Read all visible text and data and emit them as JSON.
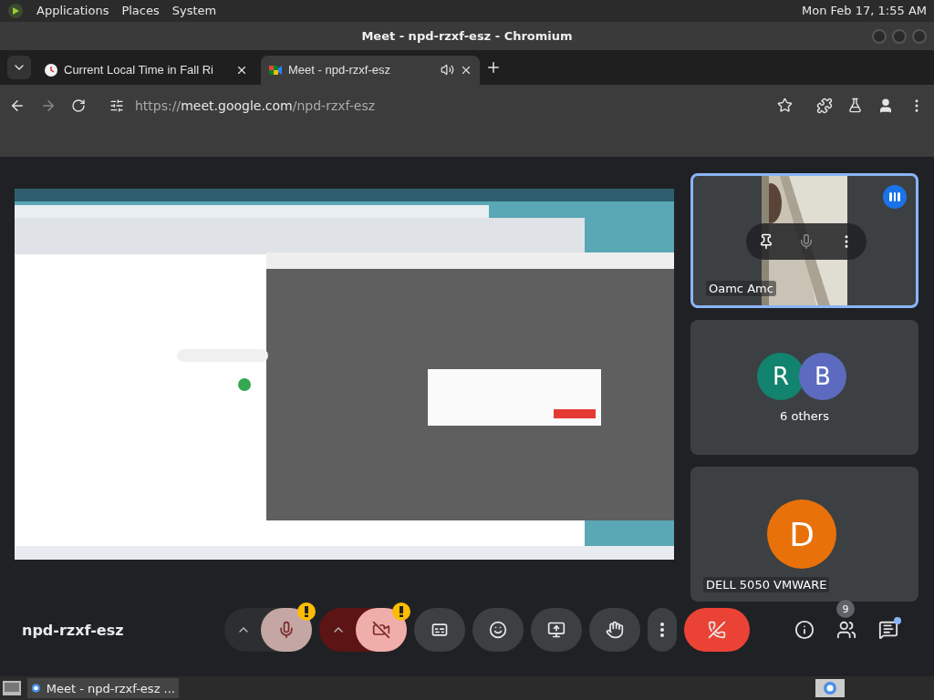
{
  "desktop_panel": {
    "menus": [
      "Applications",
      "Places",
      "System"
    ],
    "clock": "Mon Feb 17, 1:55 AM"
  },
  "window": {
    "title": "Meet - npd-rzxf-esz - Chromium"
  },
  "tabs": [
    {
      "label": "Current Local Time in Fall Ri",
      "selected": false,
      "audio": false
    },
    {
      "label": "Meet - npd-rzxf-esz",
      "selected": true,
      "audio": true
    }
  ],
  "address_bar": {
    "scheme": "https://",
    "host": "meet.google.com",
    "path": "/npd-rzxf-esz"
  },
  "tiles": [
    {
      "kind": "video",
      "name": "Oamc Amc",
      "highlighted": true,
      "speaking": true
    },
    {
      "kind": "group",
      "label": "6 others",
      "highlighted": false,
      "avatars": [
        {
          "letter": "R",
          "color": "#12836f"
        },
        {
          "letter": "B",
          "color": "#5c6bc0"
        }
      ]
    },
    {
      "kind": "avatar",
      "name": "DELL 5050 VMWARE",
      "highlighted": false,
      "avatars": [
        {
          "letter": "D",
          "color": "#e8710a"
        }
      ]
    }
  ],
  "controls": {
    "meeting_code": "npd-rzxf-esz",
    "mic": {
      "on": false,
      "warning": true
    },
    "camera": {
      "on": false,
      "warning": true
    },
    "people_count": "9",
    "chat_unread": true
  },
  "taskbar": {
    "items": [
      {
        "label": "Meet - npd-rzxf-esz ...",
        "selected": false
      }
    ]
  }
}
